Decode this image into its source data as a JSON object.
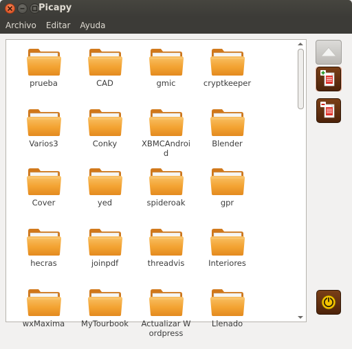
{
  "window": {
    "title": "Picapy"
  },
  "menu": {
    "items": [
      "Archivo",
      "Editar",
      "Ayuda"
    ]
  },
  "folders": [
    "prueba",
    "CAD",
    "gmic",
    "cryptkeeper",
    "Varios3",
    "Conky",
    "XBMCAndroid",
    "Blender",
    "Cover",
    "yed",
    "spideroak",
    "gpr",
    "hecras",
    "joinpdf",
    "threadvis",
    "Interiores",
    "wxMaxima",
    "MyTourbook",
    "Actualizar Wordpress",
    "Llenado"
  ],
  "colors": {
    "titlebar": "#3c3b37",
    "folder_orange": "#f3a332",
    "button_brown": "#5e2e10"
  },
  "sidebar_buttons": [
    {
      "name": "up-button",
      "icon": "up-arrow-icon"
    },
    {
      "name": "add-document-button",
      "icon": "add-document-icon"
    },
    {
      "name": "remove-document-button",
      "icon": "remove-document-icon"
    },
    {
      "name": "power-button",
      "icon": "power-icon"
    }
  ]
}
